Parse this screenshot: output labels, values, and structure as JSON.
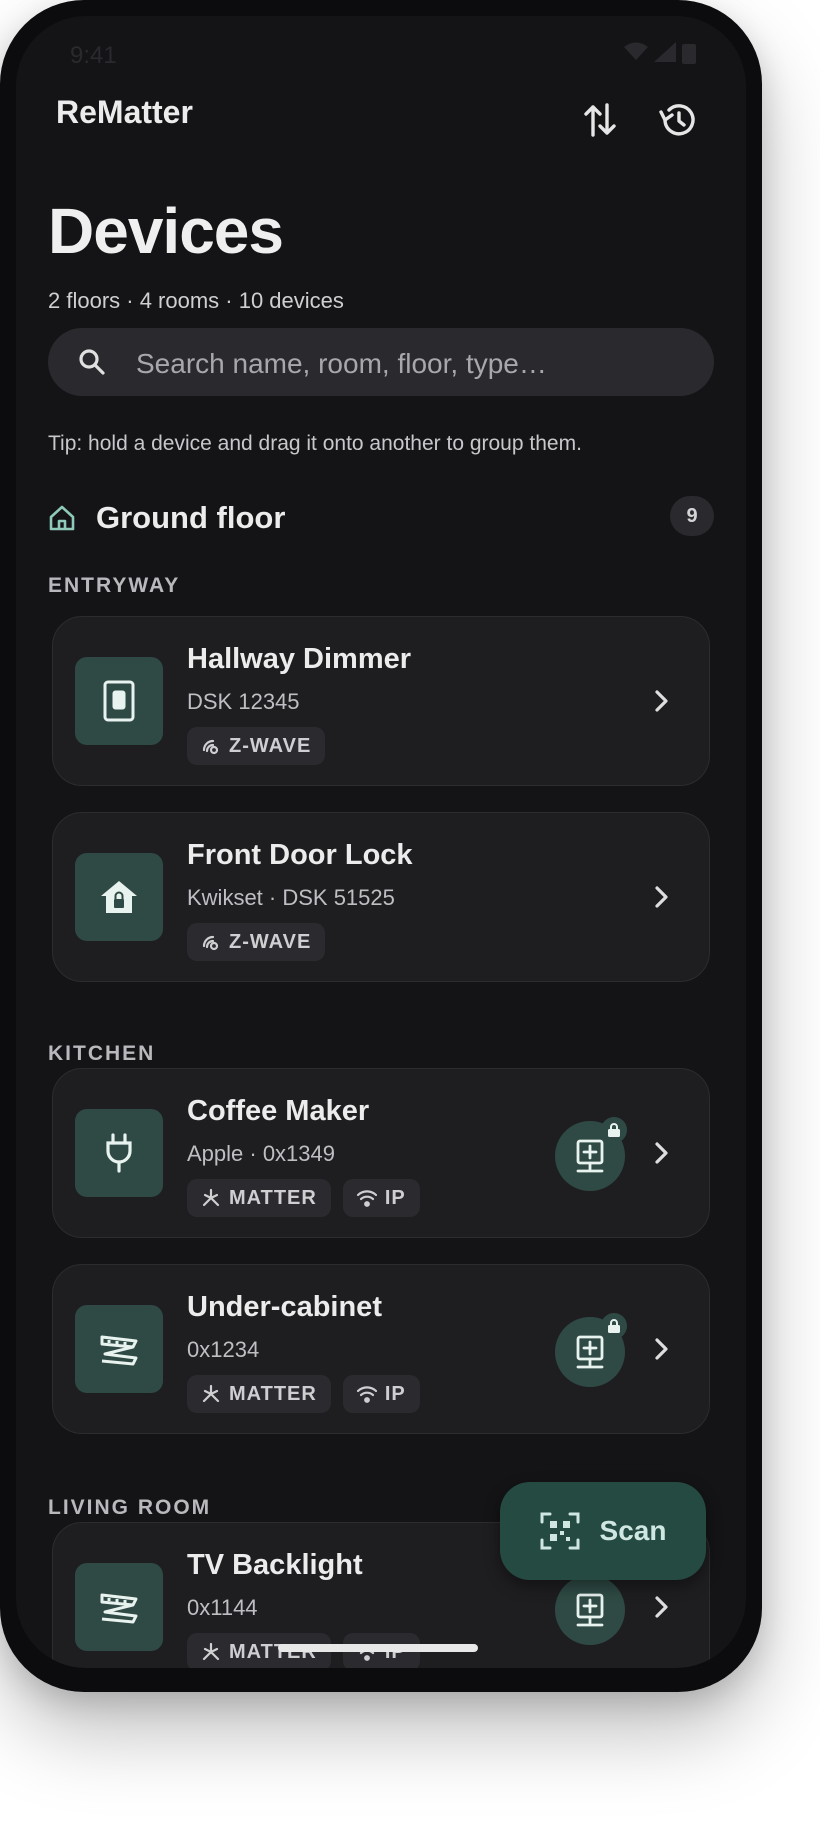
{
  "status_bar": {
    "time": "9:41"
  },
  "app_bar": {
    "title": "ReMatter",
    "sort_icon": "sort-arrows-icon",
    "history_icon": "history-icon"
  },
  "page": {
    "title": "Devices",
    "summary": "2 floors · 4 rooms · 10 devices"
  },
  "search": {
    "placeholder": "Search name, room, floor, type…"
  },
  "tip": "Tip: hold a device and drag it onto another to group them.",
  "floor": {
    "name": "Ground floor",
    "count": "9"
  },
  "rooms": {
    "entryway": "ENTRYWAY",
    "kitchen": "KITCHEN",
    "living_room": "LIVING ROOM"
  },
  "devices": [
    {
      "name": "Hallway Dimmer",
      "sub": "DSK 12345",
      "icon": "light-switch-icon",
      "chips": [
        "Z-WAVE"
      ]
    },
    {
      "name": "Front Door Lock",
      "sub": "Kwikset · DSK 51525",
      "icon": "home-lock-icon",
      "chips": [
        "Z-WAVE"
      ]
    },
    {
      "name": "Coffee Maker",
      "sub": "Apple · 0x1349",
      "icon": "plug-icon",
      "chips": [
        "MATTER",
        "IP"
      ]
    },
    {
      "name": "Under-cabinet",
      "sub": "0x1234",
      "icon": "led-strip-icon",
      "chips": [
        "MATTER",
        "IP"
      ]
    },
    {
      "name": "TV Backlight",
      "sub": "0x1144",
      "icon": "led-strip-icon",
      "chips": [
        "MATTER",
        "IP"
      ]
    }
  ],
  "scan_fab": {
    "label": "Scan",
    "icon": "qr-scan-icon"
  },
  "colors": {
    "background": "#141416",
    "card": "#1e1e21",
    "accent": "#2f4a44",
    "fab": "#244a42",
    "text": "#ececec"
  }
}
